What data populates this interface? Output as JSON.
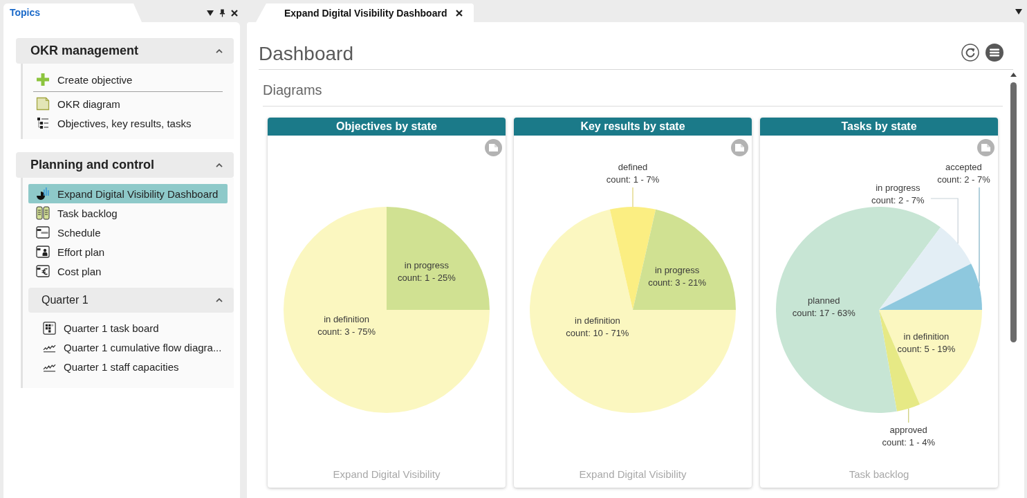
{
  "sidebar": {
    "tab": {
      "label": "Topics",
      "selected": true
    },
    "sections": [
      {
        "title": "OKR management",
        "expanded": true,
        "items": [
          {
            "label": "Create objective",
            "kind": "create",
            "selected": false
          },
          {
            "label": "OKR diagram",
            "kind": "diagram",
            "selected": false
          },
          {
            "label": "Objectives, key results, tasks",
            "kind": "hierarchy",
            "selected": false
          }
        ]
      },
      {
        "title": "Planning and control",
        "expanded": true,
        "items": [
          {
            "label": "Expand Digital Visibility Dashboard",
            "kind": "dashboard",
            "selected": true
          },
          {
            "label": "Task backlog",
            "kind": "backlog",
            "selected": false
          },
          {
            "label": "Schedule",
            "kind": "schedule",
            "selected": false
          },
          {
            "label": "Effort plan",
            "kind": "effort",
            "selected": false
          },
          {
            "label": "Cost plan",
            "kind": "cost",
            "selected": false
          }
        ],
        "children": [
          {
            "title": "Quarter 1",
            "expanded": true,
            "items": [
              {
                "label": "Quarter 1 task board",
                "kind": "board",
                "selected": false
              },
              {
                "label": "Quarter 1 cumulative flow diagra...",
                "kind": "trend",
                "selected": false
              },
              {
                "label": "Quarter 1 staff capacities",
                "kind": "trend",
                "selected": false
              }
            ]
          }
        ]
      }
    ]
  },
  "tabs": [
    {
      "label": "Expand Digital Visibility Dashboard",
      "selected": true
    }
  ],
  "dashboard": {
    "title": "Dashboard",
    "section": "Diagrams",
    "cards": [
      {
        "source": "Expand Digital Visibility",
        "chart_data": {
          "type": "pie",
          "title": "Objectives by state",
          "categories": [
            "in definition",
            "in progress"
          ],
          "values": [
            3,
            1
          ],
          "colors": [
            "#fbf7c0",
            "#d0e192"
          ],
          "value_labels": [
            "count: 3 - 75%",
            "count: 1 - 25%"
          ]
        }
      },
      {
        "source": "Expand Digital Visibility",
        "chart_data": {
          "type": "pie",
          "title": "Key results by state",
          "categories": [
            "in definition",
            "defined",
            "in progress"
          ],
          "values": [
            10,
            1,
            3
          ],
          "colors": [
            "#fbf7c0",
            "#fbee82",
            "#d0e192"
          ],
          "value_labels": [
            "count: 10 - 71%",
            "count: 1 - 7%",
            "count: 3 - 21%"
          ]
        }
      },
      {
        "source": "Task backlog",
        "chart_data": {
          "type": "pie",
          "title": "Tasks by state",
          "categories": [
            "in definition",
            "approved",
            "planned",
            "in progress",
            "accepted"
          ],
          "values": [
            5,
            1,
            17,
            2,
            2
          ],
          "colors": [
            "#fbf7c0",
            "#e6e985",
            "#c7e5d4",
            "#e3eef5",
            "#8ec8de"
          ],
          "value_labels": [
            "count: 5 - 19%",
            "count: 1 - 4%",
            "count: 17 - 63%",
            "count: 2 - 7%",
            "count: 2 - 7%"
          ]
        }
      }
    ]
  }
}
